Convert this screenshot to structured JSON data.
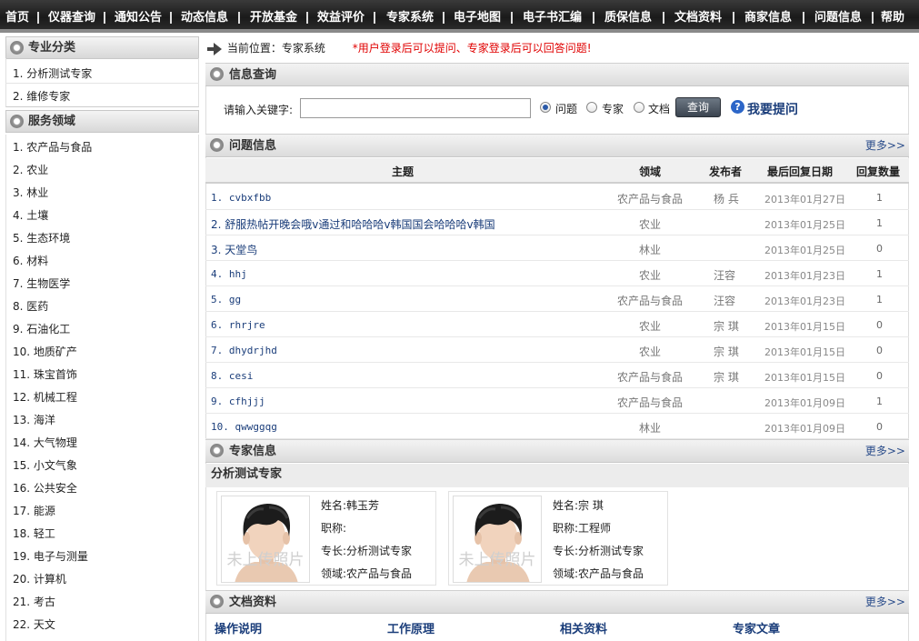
{
  "nav": [
    "首页",
    "仪器查询",
    "通知公告",
    "动态信息",
    "开放基金",
    "效益评价",
    "专家系统",
    "电子地图",
    "电子书汇编",
    "质保信息",
    "文档资料",
    "商家信息",
    "问题信息",
    "帮助"
  ],
  "sidebar": {
    "category_title": "专业分类",
    "categories": [
      "1. 分析测试专家",
      "2. 维修专家"
    ],
    "domain_title": "服务领域",
    "domains": [
      "1. 农产品与食品",
      "2. 农业",
      "3. 林业",
      "4. 土壤",
      "5. 生态环境",
      "6. 材料",
      "7. 生物医学",
      "8. 医药",
      "9. 石油化工",
      "10. 地质矿产",
      "11. 珠宝首饰",
      "12. 机械工程",
      "13. 海洋",
      "14. 大气物理",
      "15. 小文气象",
      "16. 公共安全",
      "17. 能源",
      "18. 轻工",
      "19. 电子与测量",
      "20. 计算机",
      "21. 考古",
      "22. 天文"
    ]
  },
  "breadcrumb": {
    "label": "当前位置：",
    "current": "专家系统",
    "notice": "*用户登录后可以提问、专家登录后可以回答问题!"
  },
  "search": {
    "title": "信息查询",
    "label": "请输入关键字:",
    "value": "",
    "options": [
      "问题",
      "专家",
      "文档"
    ],
    "selected": "问题",
    "button": "查询",
    "ask": "我要提问"
  },
  "questions": {
    "title": "问题信息",
    "more": "更多>>",
    "headers": [
      "主题",
      "领域",
      "发布者",
      "最后回复日期",
      "回复数量"
    ],
    "rows": [
      {
        "topic": "1. cvbxfbb",
        "domain": "农产品与食品",
        "publisher": "杨 兵",
        "date": "2013年01月27日",
        "count": "1"
      },
      {
        "topic": "2. 舒服热帖开晚会哦v通过和哈哈哈v韩国国会哈哈哈v韩国",
        "domain": "农业",
        "publisher": "",
        "date": "2013年01月25日",
        "count": "1"
      },
      {
        "topic": "3. 天堂鸟",
        "domain": "林业",
        "publisher": "",
        "date": "2013年01月25日",
        "count": "0"
      },
      {
        "topic": "4. hhj",
        "domain": "农业",
        "publisher": "汪容",
        "date": "2013年01月23日",
        "count": "1"
      },
      {
        "topic": "5. gg",
        "domain": "农产品与食品",
        "publisher": "汪容",
        "date": "2013年01月23日",
        "count": "1"
      },
      {
        "topic": "6. rhrjre",
        "domain": "农业",
        "publisher": "宗 琪",
        "date": "2013年01月15日",
        "count": "0"
      },
      {
        "topic": "7. dhydrjhd",
        "domain": "农业",
        "publisher": "宗 琪",
        "date": "2013年01月15日",
        "count": "0"
      },
      {
        "topic": "8. cesi",
        "domain": "农产品与食品",
        "publisher": "宗 琪",
        "date": "2013年01月15日",
        "count": "0"
      },
      {
        "topic": "9. cfhjjj",
        "domain": "农产品与食品",
        "publisher": "",
        "date": "2013年01月09日",
        "count": "1"
      },
      {
        "topic": "10. qwwggqg",
        "domain": "林业",
        "publisher": "",
        "date": "2013年01月09日",
        "count": "0"
      }
    ]
  },
  "experts": {
    "title": "专家信息",
    "more": "更多>>",
    "group": "分析测试专家",
    "photo_placeholder": "未上传照片",
    "cards": [
      {
        "name_label": "姓名:",
        "name": "韩玉芳",
        "title_label": "职称:",
        "title": "",
        "specialty_label": "专长:",
        "specialty": "分析测试专家",
        "domain_label": "领域:",
        "domain": "农产品与食品"
      },
      {
        "name_label": "姓名:",
        "name": "宗 琪",
        "title_label": "职称:",
        "title": "工程师",
        "specialty_label": "专长:",
        "specialty": "分析测试专家",
        "domain_label": "领域:",
        "domain": "农产品与食品"
      }
    ]
  },
  "documents": {
    "title": "文档资料",
    "more": "更多>>",
    "links": [
      "操作说明",
      "工作原理",
      "相关资料",
      "专家文章"
    ]
  }
}
